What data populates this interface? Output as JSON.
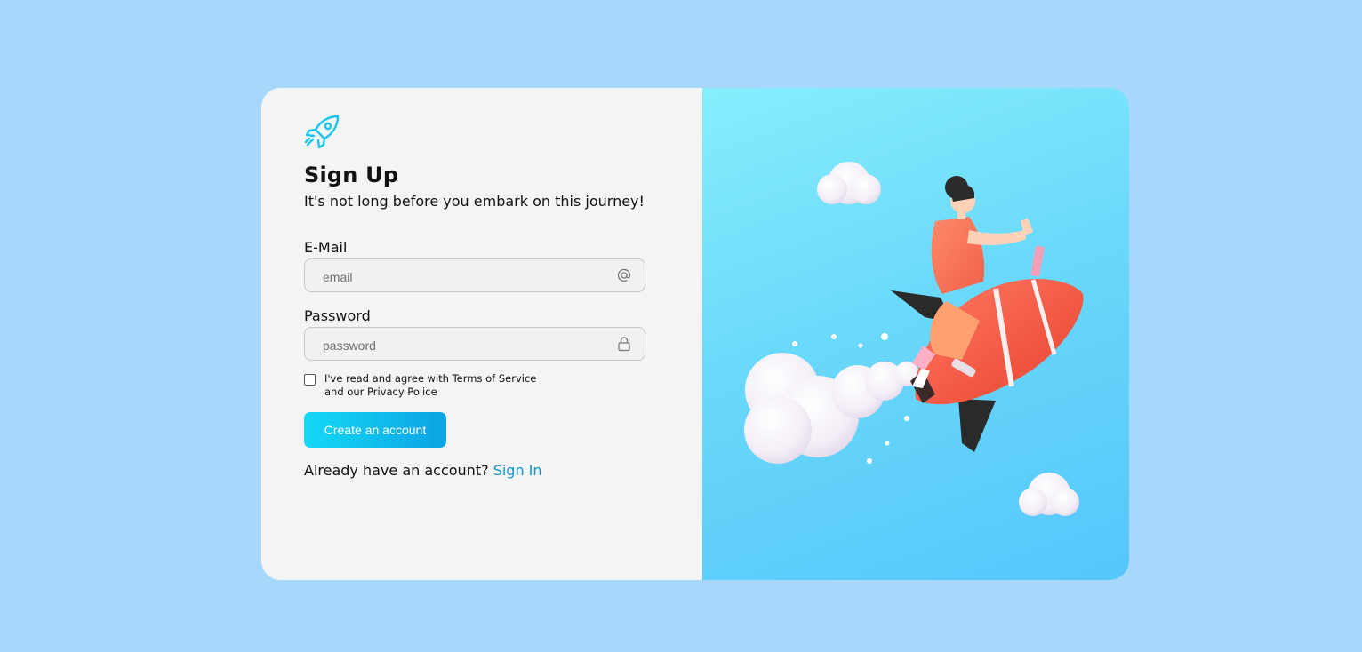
{
  "header": {
    "logo_icon": "rocket-icon",
    "title": "Sign Up",
    "subtitle": "It's not long before you embark on this journey!"
  },
  "form": {
    "email": {
      "label": "E-Mail",
      "placeholder": "email",
      "value": "",
      "icon": "at-icon"
    },
    "password": {
      "label": "Password",
      "placeholder": "password",
      "value": "",
      "icon": "lock-icon"
    },
    "agreement": {
      "checked": false,
      "text": "I've read and agree with Terms of Service and our Privacy Police"
    },
    "submit_label": "Create an account"
  },
  "footer": {
    "prompt": "Already have an account?",
    "link_label": "Sign In"
  },
  "illustration": {
    "subject": "person riding a rocket among clouds",
    "icons": [
      "cloud-icon",
      "rocket-icon"
    ]
  },
  "colors": {
    "page_background": "#a7d8fb",
    "accent": "#0ba3e4",
    "accent_light": "#14d9f5",
    "link": "#1198c9",
    "rocket": "#f45b47"
  }
}
